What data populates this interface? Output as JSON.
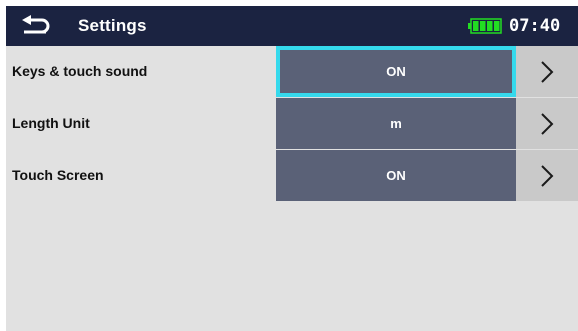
{
  "header": {
    "title": "Settings",
    "time": "07:40",
    "back_icon": "back-arrow-icon",
    "battery_icon": "battery-full-icon"
  },
  "settings": [
    {
      "label": "Keys & touch sound",
      "value": "ON",
      "selected": true
    },
    {
      "label": "Length Unit",
      "value": "m",
      "selected": false
    },
    {
      "label": "Touch Screen",
      "value": "ON",
      "selected": false
    }
  ],
  "colors": {
    "header_bg": "#1b2341",
    "value_bg": "#5a6177",
    "selection_border": "#35d9ec",
    "battery": "#22dd22",
    "screen_bg": "#e1e1e1"
  }
}
